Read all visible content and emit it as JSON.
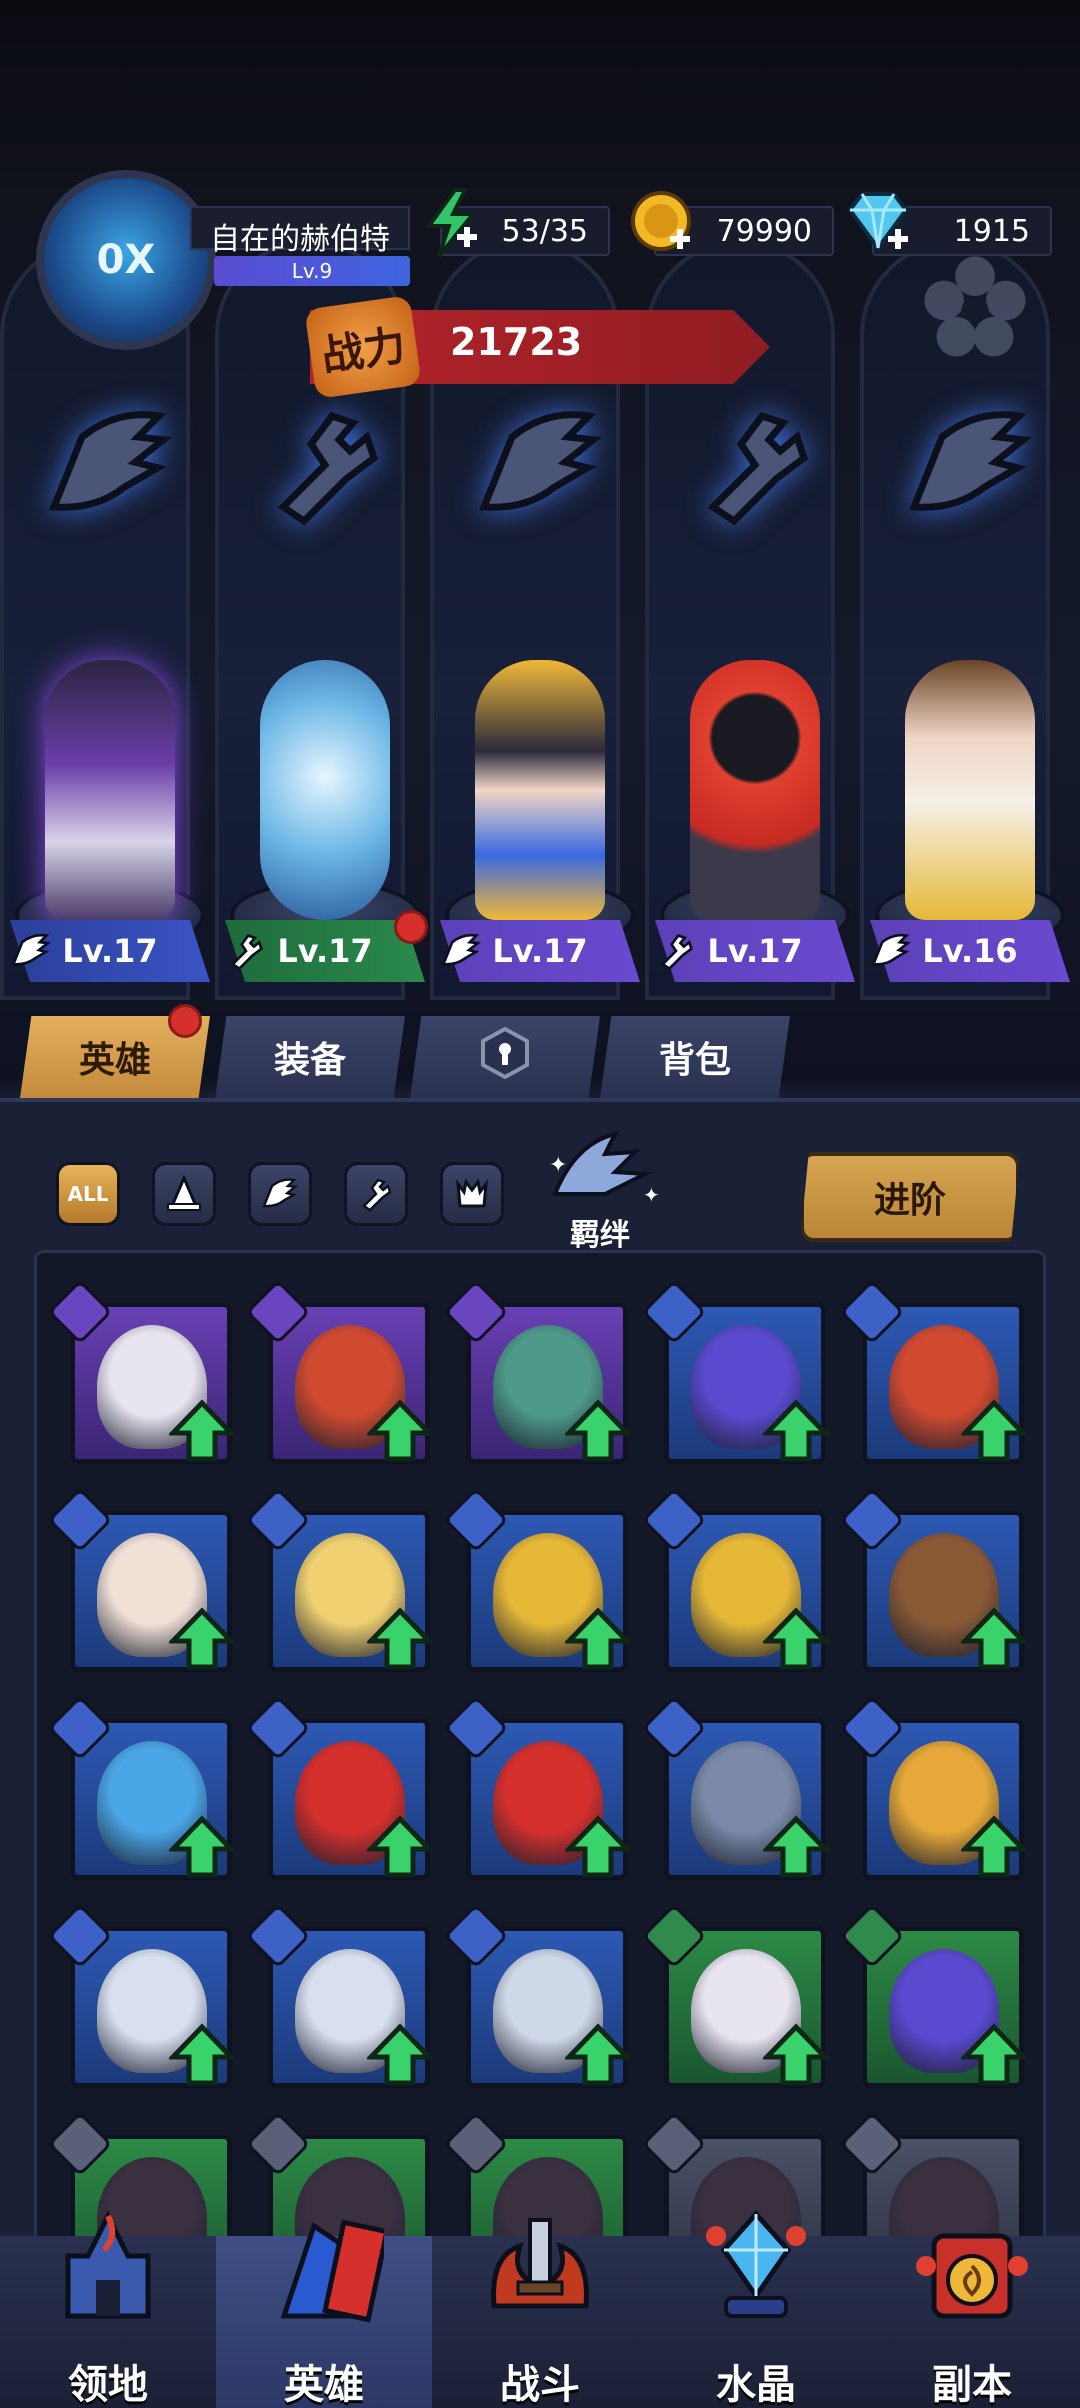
{
  "player": {
    "name": "自在的赫伯特",
    "level": "Lv.9",
    "avatar_text": "0X"
  },
  "resources": {
    "energy": "53/35",
    "gold": "79990",
    "diamond": "1915"
  },
  "power": {
    "label": "战力",
    "value": "21723"
  },
  "lineup": [
    {
      "level": "Lv.17",
      "class_icon": "wing-icon",
      "plate": "blue"
    },
    {
      "level": "Lv.17",
      "class_icon": "wrench-icon",
      "plate": "green"
    },
    {
      "level": "Lv.17",
      "class_icon": "wing-icon",
      "plate": "purple"
    },
    {
      "level": "Lv.17",
      "class_icon": "wrench-icon",
      "plate": "purple"
    },
    {
      "level": "Lv.16",
      "class_icon": "wing-icon",
      "plate": "purple"
    }
  ],
  "tabs": {
    "heroes": "英雄",
    "equipment": "装备",
    "locked": "",
    "bag": "背包"
  },
  "filters": {
    "all": "ALL"
  },
  "bond": {
    "label": "羁绊"
  },
  "advance": {
    "label": "进阶"
  },
  "colors": {
    "accent_gold": "#d6a552",
    "power_red": "#b4232a",
    "panel_bg": "#1a2036"
  },
  "nav": {
    "territory": "领地",
    "heroes": "英雄",
    "battle": "战斗",
    "crystal": "水晶",
    "dungeon": "副本"
  }
}
